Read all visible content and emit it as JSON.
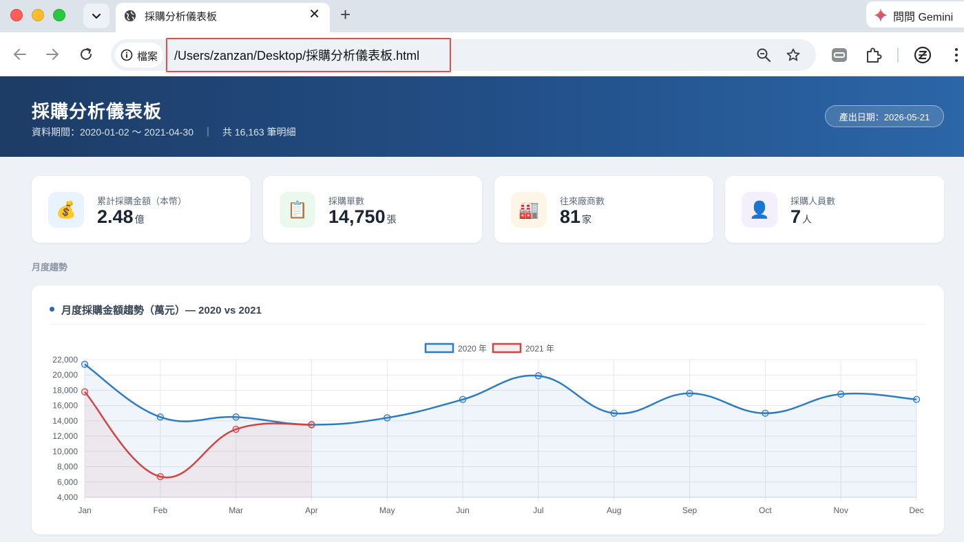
{
  "browser": {
    "tab_title": "採購分析儀表板",
    "site_info_label": "檔案",
    "url": "/Users/zanzan/Desktop/採購分析儀表板.html",
    "gemini_label": "問問 Gemini"
  },
  "header": {
    "title": "採購分析儀表板",
    "subtitle": "資料期間：2020-01-02 ～ 2021-04-30　｜　共 16,163 筆明細",
    "date_badge": "產出日期：2026-05-21"
  },
  "kpis": [
    {
      "label": "累計採購金額（本幣）",
      "value": "2.48",
      "unit": "億",
      "icon": "money-bag-icon",
      "icon_glyph": "💰",
      "icon_bg": "#e9f3fd"
    },
    {
      "label": "採購單數",
      "value": "14,750",
      "unit": "張",
      "icon": "clipboard-icon",
      "icon_glyph": "📋",
      "icon_bg": "#eaf8ee"
    },
    {
      "label": "往來廠商數",
      "value": "81",
      "unit": "家",
      "icon": "factory-icon",
      "icon_glyph": "🏭",
      "icon_bg": "#fdf6e6"
    },
    {
      "label": "採購人員數",
      "value": "7",
      "unit": "人",
      "icon": "person-icon",
      "icon_glyph": "👤",
      "icon_bg": "#f3effc"
    }
  ],
  "section_label": "月度趨勢",
  "chart_title": "月度採購金額趨勢（萬元）— 2020 vs 2021",
  "chart_data": {
    "type": "line",
    "categories": [
      "Jan",
      "Feb",
      "Mar",
      "Apr",
      "May",
      "Jun",
      "Jul",
      "Aug",
      "Sep",
      "Oct",
      "Nov",
      "Dec"
    ],
    "series": [
      {
        "name": "2020 年",
        "color": "#2f7bc1",
        "values": [
          21400,
          14500,
          14500,
          13500,
          14400,
          16800,
          19900,
          15000,
          17600,
          15000,
          17500,
          16800
        ]
      },
      {
        "name": "2021 年",
        "color": "#d24344",
        "values": [
          17800,
          6700,
          12900,
          13500
        ]
      }
    ],
    "ylim": [
      4000,
      22000
    ],
    "yticks": [
      4000,
      6000,
      8000,
      10000,
      12000,
      14000,
      16000,
      18000,
      20000,
      22000
    ],
    "legend": "top-center",
    "grid": true,
    "fill": true
  }
}
